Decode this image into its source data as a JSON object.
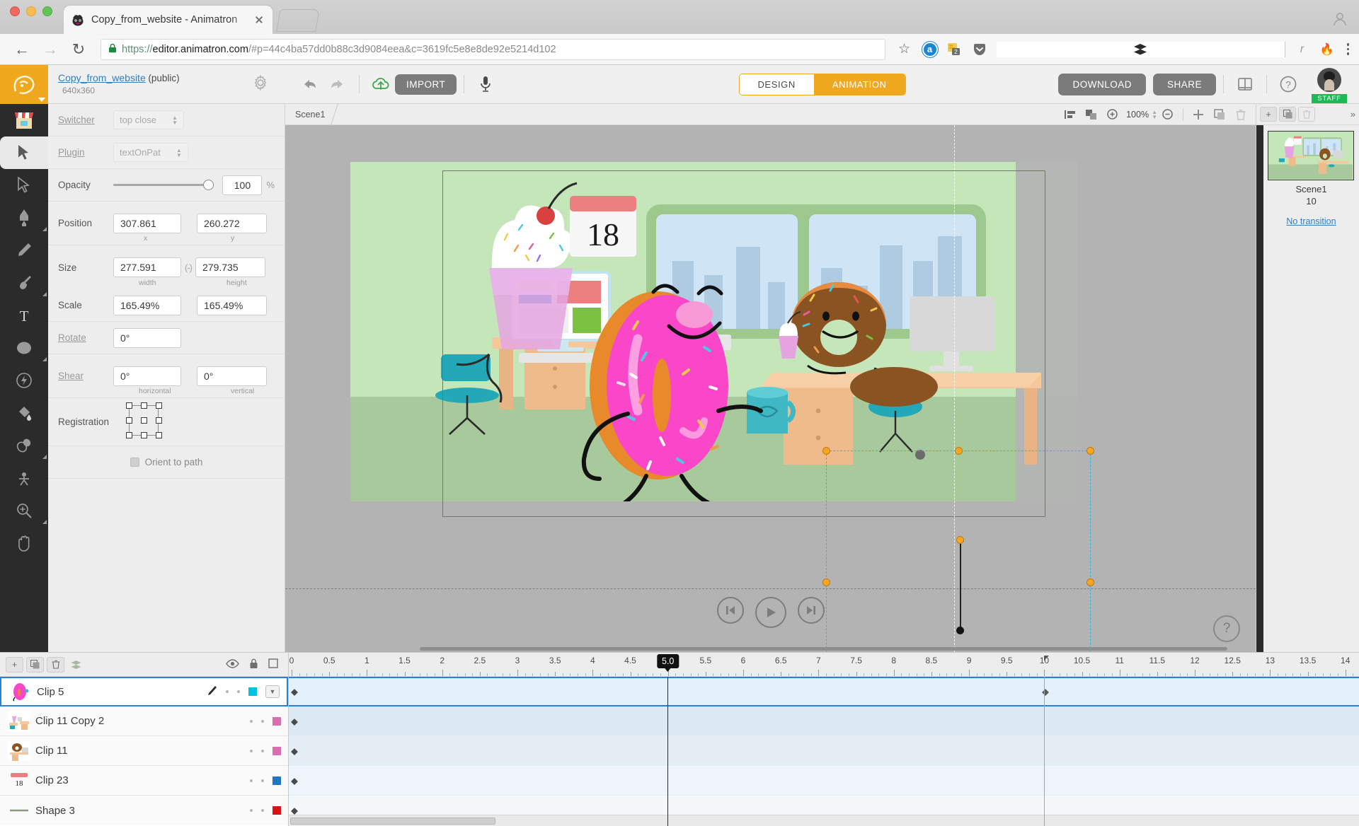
{
  "browser": {
    "tab_title": "Copy_from_website - Animatron",
    "favicon_name": "animatron-favicon",
    "url_scheme": "https://",
    "url_host": "editor.animatron.com",
    "url_rest": "/#p=44c4ba57dd0b88c3d9084eea&c=3619fc5e8e8de92e5214d102",
    "lock_label": "secure-lock",
    "back": "←",
    "forward": "→",
    "reload": "↻",
    "bookmark_star": "☆",
    "extensions": [
      {
        "name": "amazon-assistant-icon",
        "glyph": "a"
      },
      {
        "name": "notes-extension-icon",
        "glyph": "2"
      },
      {
        "name": "pocket-icon",
        "glyph": "▼"
      },
      {
        "name": "layers-extension-icon",
        "glyph": "☰"
      },
      {
        "name": "grammarly-icon",
        "glyph": "r"
      },
      {
        "name": "flame-extension-icon",
        "glyph": "🔥"
      }
    ]
  },
  "header": {
    "project_name": "Copy_from_website",
    "project_visibility": "(public)",
    "project_dimensions": "640x360",
    "settings_icon": "gear-icon",
    "undo_icon": "undo-arrow-icon",
    "redo_icon": "redo-arrow-icon",
    "upload_icon": "cloud-upload-icon",
    "import_label": "IMPORT",
    "mic_icon": "microphone-icon",
    "mode_design": "DESIGN",
    "mode_animation": "ANIMATION",
    "active_mode": "ANIMATION",
    "download_label": "DOWNLOAD",
    "share_label": "SHARE",
    "book_icon": "library-panel-icon",
    "help_icon": "help-question-icon",
    "avatar_badge": "STAFF"
  },
  "tools": [
    {
      "name": "tool-library",
      "glyph": "store"
    },
    {
      "name": "tool-select",
      "glyph": "cursor-arrow",
      "active": true
    },
    {
      "name": "tool-subselect",
      "glyph": "cursor-outline"
    },
    {
      "name": "tool-pen",
      "glyph": "pen-nib"
    },
    {
      "name": "tool-pencil",
      "glyph": "pencil"
    },
    {
      "name": "tool-brush",
      "glyph": "paint-brush"
    },
    {
      "name": "tool-text",
      "glyph": "T"
    },
    {
      "name": "tool-shape",
      "glyph": "ellipse"
    },
    {
      "name": "tool-eraser-magic",
      "glyph": "magic-bolt"
    },
    {
      "name": "tool-paint-bucket",
      "glyph": "paint-bucket"
    },
    {
      "name": "tool-eyedropper",
      "glyph": "ink-drop"
    },
    {
      "name": "tool-bone",
      "glyph": "rig-bone"
    },
    {
      "name": "tool-zoom",
      "glyph": "magnifier-plus"
    },
    {
      "name": "tool-hand",
      "glyph": "hand"
    }
  ],
  "properties": {
    "switcher_label": "Switcher",
    "switcher_value": "top close",
    "plugin_label": "Plugin",
    "plugin_value": "textOnPat",
    "opacity_label": "Opacity",
    "opacity_value": "100",
    "opacity_unit": "%",
    "position_label": "Position",
    "position_x": "307.861",
    "position_y": "260.272",
    "position_x_sub": "x",
    "position_y_sub": "y",
    "size_label": "Size",
    "size_w": "277.591",
    "size_h": "279.735",
    "size_w_sub": "width",
    "size_h_sub": "height",
    "link_icon": "chain-link-icon",
    "scale_label": "Scale",
    "scale_x": "165.49%",
    "scale_y": "165.49%",
    "rotate_label": "Rotate",
    "rotate_value": "0°",
    "shear_label": "Shear",
    "shear_h": "0°",
    "shear_v": "0°",
    "shear_h_sub": "horizontal",
    "shear_v_sub": "vertical",
    "registration_label": "Registration",
    "orient_label": "Orient to path",
    "orient_checked": false
  },
  "canvas": {
    "scene_tab": "Scene1",
    "align_icon": "align-left-icon",
    "arrange_icon": "arrange-objects-icon",
    "zoom_in_icon": "zoom-in-icon",
    "zoom_value": "100%",
    "zoom_out_icon": "zoom-out-icon",
    "add_icon": "add-icon",
    "duplicate_icon": "duplicate-icon",
    "delete_icon": "trash-icon",
    "calendar_day": "18",
    "playback": {
      "prev_icon": "skip-to-start-icon",
      "play_icon": "play-icon",
      "next_icon": "skip-to-end-icon"
    },
    "help_fab": "?"
  },
  "scenes_panel": {
    "add_icon": "add-scene-icon",
    "duplicate_icon": "duplicate-scene-icon",
    "delete_icon": "delete-scene-icon",
    "collapse_icon": "collapse-panel-icon",
    "scene_label": "Scene1",
    "scene_duration": "10",
    "transition_label": "No transition"
  },
  "timeline": {
    "toolbar": {
      "add_layer_icon": "add-layer-icon",
      "duplicate_layer_icon": "duplicate-layer-icon",
      "delete_layer_icon": "delete-layer-icon",
      "group_layers_icon": "group-layers-icon",
      "eye_icon": "visibility-eye-icon",
      "lock_icon": "lock-icon",
      "outline_icon": "outline-square-icon"
    },
    "layers": [
      {
        "name": "Clip 5",
        "thumb": "pink-donut-thumb",
        "color": "#00c3e3",
        "selected": true,
        "has_pen": true
      },
      {
        "name": "Clip 11 Copy 2",
        "thumb": "office-scene-thumb",
        "color": "#d96fb0",
        "selected": false,
        "has_pen": false
      },
      {
        "name": "Clip 11",
        "thumb": "desk-scene-thumb",
        "color": "#d96fb0",
        "selected": false,
        "has_pen": false
      },
      {
        "name": "Clip 23",
        "thumb": "calendar-18-thumb",
        "color": "#1f77c4",
        "selected": false,
        "has_pen": false
      },
      {
        "name": "Shape 3",
        "thumb": "line-shape-thumb",
        "color": "#d71414",
        "selected": false,
        "has_pen": false
      }
    ],
    "ruler_labels": [
      "0",
      "0.5",
      "1",
      "1.5",
      "2",
      "2.5",
      "3",
      "3.5",
      "4",
      "4.5",
      "5.5",
      "6",
      "6.5",
      "7",
      "7.5",
      "8",
      "8.5",
      "9",
      "9.5",
      "10",
      "10.5",
      "11",
      "11.5",
      "12",
      "12.5",
      "13",
      "13.5",
      "14"
    ],
    "playhead_time": "5.0",
    "marker_time": "10",
    "ruler_start": 0,
    "ruler_end": 14.2
  },
  "colors": {
    "accent_orange": "#f0a81e",
    "select_blue": "#2b7fd4",
    "handle_orange": "#f5a623",
    "staff_green": "#1db954",
    "link_blue": "#2f7fc1"
  }
}
